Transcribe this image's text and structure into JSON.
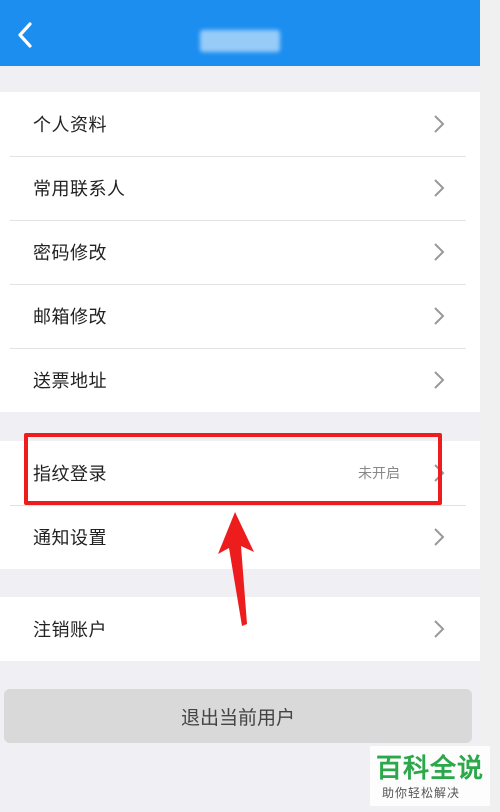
{
  "header": {
    "back_icon": "chevron-left-icon",
    "title": ""
  },
  "account_group": [
    {
      "label": "个人资料"
    },
    {
      "label": "常用联系人"
    },
    {
      "label": "密码修改"
    },
    {
      "label": "邮箱修改"
    },
    {
      "label": "送票地址"
    }
  ],
  "security_group": [
    {
      "label": "指纹登录",
      "value": "未开启"
    },
    {
      "label": "通知设置"
    }
  ],
  "cancel_group": [
    {
      "label": "注销账户"
    }
  ],
  "logout_button": "退出当前用户",
  "watermark": {
    "main": "百科全说",
    "sub": "助你轻松解决"
  },
  "colors": {
    "header": "#1c8ef0",
    "annotation": "#ee1d1d",
    "watermark": "#2aa84a"
  }
}
